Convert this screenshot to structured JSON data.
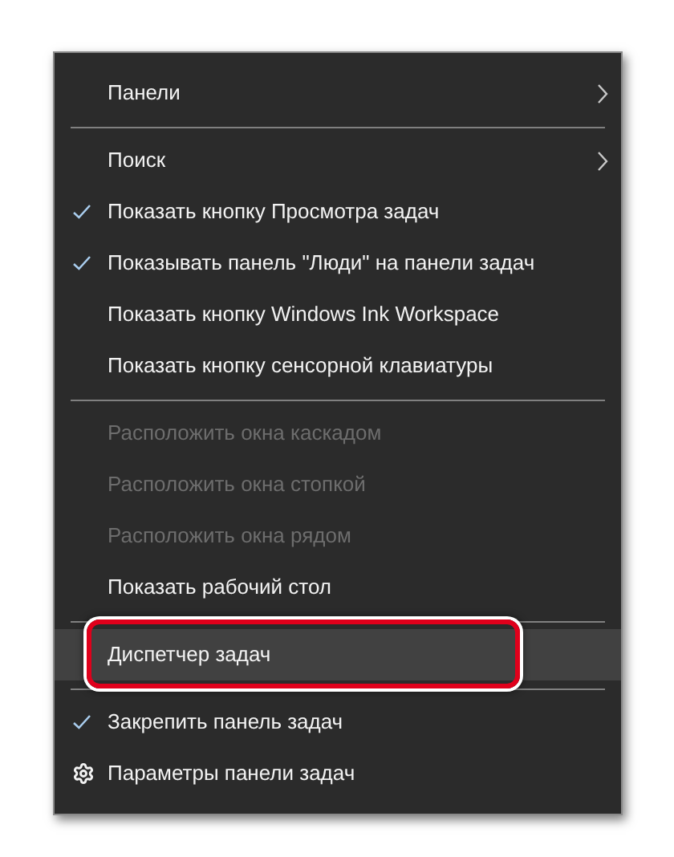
{
  "menu": {
    "items": [
      {
        "kind": "item",
        "label": "Панели",
        "checked": false,
        "disabled": false,
        "selected": false,
        "submenu": true,
        "annotated": false
      },
      {
        "kind": "separator"
      },
      {
        "kind": "item",
        "label": "Поиск",
        "checked": false,
        "disabled": false,
        "selected": false,
        "submenu": true,
        "annotated": false
      },
      {
        "kind": "item",
        "label": "Показать кнопку Просмотра задач",
        "checked": true,
        "disabled": false,
        "selected": false,
        "submenu": false,
        "annotated": false
      },
      {
        "kind": "item",
        "label": "Показывать панель \"Люди\" на панели задач",
        "checked": true,
        "disabled": false,
        "selected": false,
        "submenu": false,
        "annotated": false
      },
      {
        "kind": "item",
        "label": "Показать кнопку Windows Ink Workspace",
        "checked": false,
        "disabled": false,
        "selected": false,
        "submenu": false,
        "annotated": false
      },
      {
        "kind": "item",
        "label": "Показать кнопку сенсорной клавиатуры",
        "checked": false,
        "disabled": false,
        "selected": false,
        "submenu": false,
        "annotated": false
      },
      {
        "kind": "separator"
      },
      {
        "kind": "item",
        "label": "Расположить окна каскадом",
        "checked": false,
        "disabled": true,
        "selected": false,
        "submenu": false,
        "annotated": false
      },
      {
        "kind": "item",
        "label": "Расположить окна стопкой",
        "checked": false,
        "disabled": true,
        "selected": false,
        "submenu": false,
        "annotated": false
      },
      {
        "kind": "item",
        "label": "Расположить окна рядом",
        "checked": false,
        "disabled": true,
        "selected": false,
        "submenu": false,
        "annotated": false
      },
      {
        "kind": "item",
        "label": "Показать рабочий стол",
        "checked": false,
        "disabled": false,
        "selected": false,
        "submenu": false,
        "annotated": false
      },
      {
        "kind": "separator"
      },
      {
        "kind": "item",
        "label": "Диспетчер задач",
        "checked": false,
        "disabled": false,
        "selected": true,
        "submenu": false,
        "annotated": true
      },
      {
        "kind": "separator"
      },
      {
        "kind": "item",
        "label": "Закрепить панель задач",
        "checked": true,
        "disabled": false,
        "selected": false,
        "submenu": false,
        "annotated": false
      },
      {
        "kind": "settings",
        "label": "Параметры панели задач",
        "disabled": false,
        "selected": false,
        "submenu": false,
        "annotated": false
      }
    ]
  }
}
